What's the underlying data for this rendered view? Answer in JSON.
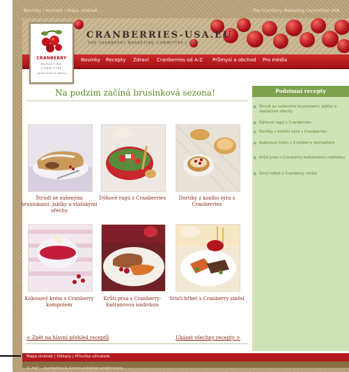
{
  "topbar": {
    "left_links": "Novinky | Kontakt | Mapa stránek",
    "right_text": "The Cranberry Marketing Committee USA"
  },
  "header": {
    "site_title": "CRANBERRIES-USA.EU",
    "site_subtitle": "THE CRANBERRY MARKETING COMMITTEE | USA",
    "logo_name": "CRANBERRY",
    "logo_lines": [
      "MARKETING",
      "COMMITTEE",
      "UNITED STATES OF AMERICA"
    ]
  },
  "nav": {
    "items": [
      "Novinky",
      "Recepty",
      "Zdraví",
      "Cranberries od A-Z",
      "Průmysl a obchod",
      "Pro média"
    ]
  },
  "main": {
    "title": "Na podzim začíná brusinková sezona!",
    "recipes": [
      {
        "caption": "Štrúdl se sušenými brusinkami, jablky a vlašskými ořechy",
        "image": "strudel"
      },
      {
        "caption": "Dýňové ragú s Cranberries",
        "image": "salad-bowl"
      },
      {
        "caption": "Dortíky z kozího sýra s Cranberries",
        "image": "tartlets"
      },
      {
        "caption": "Kokosový krém s Cranberry kompotem",
        "image": "coconut-cream"
      },
      {
        "caption": "Krůtí prsa s Cranberry-kaštanovou nádivkou",
        "image": "turkey-plate"
      },
      {
        "caption": "Srnčí hřbet s Cranberry směsí",
        "image": "venison-plate"
      }
    ],
    "back_link": "< Zpět na hlavní přehled receptů",
    "all_link": "Ukázat všechny recepty >"
  },
  "sidebar": {
    "title": "Podzimní recepty",
    "items": [
      "Štrúdl se sušenými brusinkami, jablky a vlašskými ořechy",
      "Dýňové ragú s Cranberries",
      "Dortíky z kozího sýra s Cranberries",
      "Kokosový krém s Cranberry kompotem",
      "Krůtí prsa s Cranberry-kaštanovou nádivkou",
      "Srnčí hřbet s Cranberry směsí"
    ]
  },
  "footer": {
    "links": "Mapa stránek | Odkazy | Příručka uživatele",
    "copyright": "© mk² – marketing & kommunikation gmbh bonn"
  }
}
